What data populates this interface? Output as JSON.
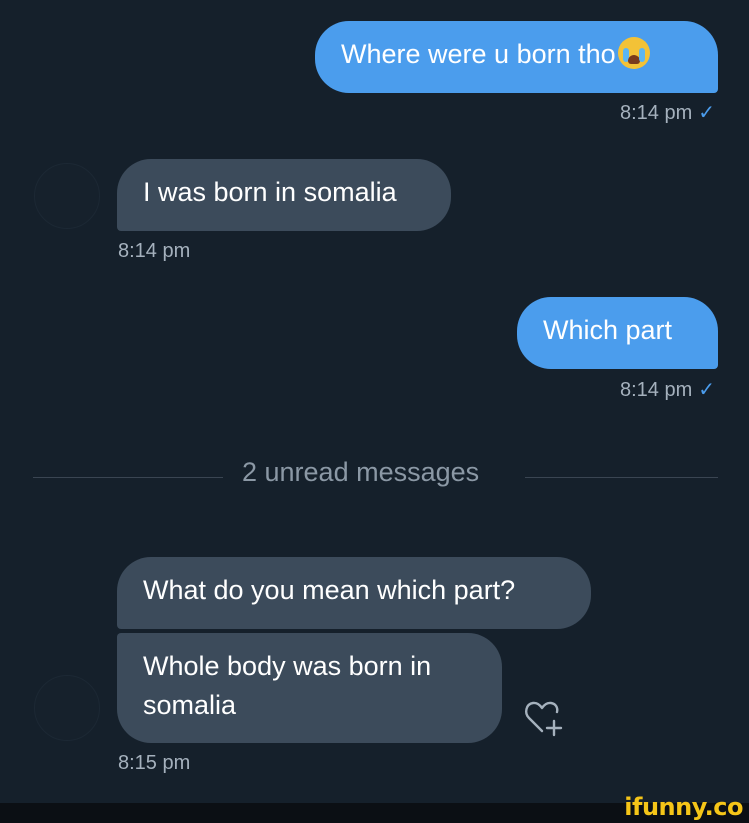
{
  "messages": [
    {
      "side": "out",
      "text": "Where were u born tho",
      "emoji": "loudly-crying-face",
      "time": "8:14 pm",
      "status": "✓"
    },
    {
      "side": "in",
      "text": "I was born in somalia",
      "time": "8:14 pm"
    },
    {
      "side": "out",
      "text": "Which part",
      "time": "8:14 pm",
      "status": "✓"
    },
    {
      "side": "in",
      "text": "What do you mean which part?"
    },
    {
      "side": "in",
      "text": "Whole body was born in somalia",
      "line1": "Whole body was born in",
      "line2": "somalia",
      "time": "8:15 pm"
    }
  ],
  "divider": {
    "text": "2 unread messages"
  },
  "reaction": {
    "icon": "heart-plus-icon"
  },
  "watermark": {
    "text": "ifunny.co"
  },
  "colors": {
    "background": "#15202b",
    "outgoing_bubble": "#4b9ded",
    "incoming_bubble": "#3c4b5b",
    "timestamp": "#a5b1bd",
    "check": "#4b9ded"
  }
}
